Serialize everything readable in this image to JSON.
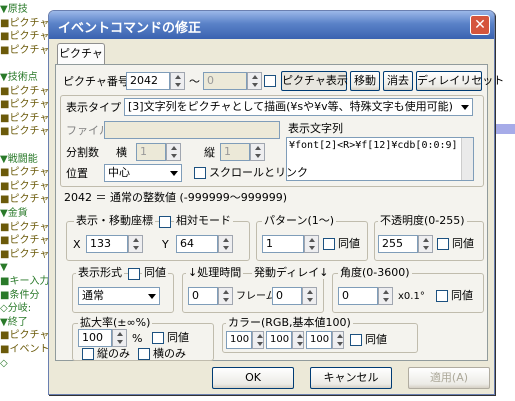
{
  "background_tree": {
    "rows": [
      {
        "prefix": "▼",
        "text": "原技",
        "cls": "tri"
      },
      {
        "prefix": "■",
        "text": "ピクチャ表",
        "cls": "sq"
      },
      {
        "prefix": "■",
        "text": "ピクチャ表",
        "cls": "sq"
      },
      {
        "prefix": "■",
        "text": "ピクチャ表",
        "cls": "sq"
      },
      {
        "prefix": "",
        "text": "",
        "cls": "sq"
      },
      {
        "prefix": "▼",
        "text": "技術点",
        "cls": "tri"
      },
      {
        "prefix": "■",
        "text": "ピクチャ表",
        "cls": "sq"
      },
      {
        "prefix": "■",
        "text": "ピクチャ表",
        "cls": "sq"
      },
      {
        "prefix": "■",
        "text": "ピクチャ表",
        "cls": "sq"
      },
      {
        "prefix": "■",
        "text": "ピクチャ表",
        "cls": "sq"
      },
      {
        "prefix": "",
        "text": "",
        "cls": "sq"
      },
      {
        "prefix": "▼",
        "text": "戦闘能",
        "cls": "tri"
      },
      {
        "prefix": "■",
        "text": "ピクチャ表",
        "cls": "sq"
      },
      {
        "prefix": "■",
        "text": "ピクチャ表",
        "cls": "sq"
      },
      {
        "prefix": "■",
        "text": "ピクチャ表",
        "cls": "sq"
      },
      {
        "prefix": "▼",
        "text": "金貨",
        "cls": "tri"
      },
      {
        "prefix": "■",
        "text": "ピクチャ表",
        "cls": "sq"
      },
      {
        "prefix": "■",
        "text": "ピクチャ表",
        "cls": "sq"
      },
      {
        "prefix": "■",
        "text": "ピクチャ表",
        "cls": "sq"
      },
      {
        "prefix": "▼",
        "text": "",
        "cls": "tri"
      },
      {
        "prefix": "■",
        "text": "キー入力",
        "cls": "tg"
      },
      {
        "prefix": "■",
        "text": "条件分",
        "cls": "tg"
      },
      {
        "prefix": "◇",
        "text": "分岐:",
        "cls": "tg"
      },
      {
        "prefix": " ▼",
        "text": "終了",
        "cls": "tri"
      },
      {
        "prefix": "  ■",
        "text": "ピクチャ",
        "cls": "sq"
      },
      {
        "prefix": "  ■",
        "text": "イベント",
        "cls": "sq"
      },
      {
        "prefix": "  ◇",
        "text": "",
        "cls": "tg"
      }
    ]
  },
  "dialog": {
    "title": "イベントコマンドの修正",
    "close": "✕",
    "tab": "ピクチャ",
    "picture_no_label": "ピクチャ番号",
    "picture_no": "2042",
    "tilde": "～",
    "picture_no_to": "0",
    "btn_show": "ピクチャ表示",
    "btn_move": "移動",
    "btn_erase": "消去",
    "btn_delay_reset": "ディレイリセット",
    "display_type_label": "表示タイプ",
    "display_type_value": "[3]文字列をピクチャとして描画(¥sや¥v等、特殊文字も使用可能)",
    "file_label": "ファイル",
    "display_text_label": "表示文字列",
    "display_text": "¥font[2]<R>¥f[12]¥cdb[0:0:9]",
    "split_label": "分割数",
    "split_h_label": "横",
    "split_h": "1",
    "split_v_label": "縦",
    "split_v": "1",
    "position_label": "位置",
    "position_value": "中心",
    "scroll_link_label": "スクロールとリンク",
    "value_info": "2042 ＝ 通常の整数値 (-999999～999999)",
    "coord_group": "表示・移動座標",
    "relative_mode": "相対モード",
    "x_label": "X",
    "x_value": "133",
    "y_label": "Y",
    "y_value": "64",
    "pattern_group": "パターン(1～)",
    "pattern_value": "1",
    "same_value": "同値",
    "opacity_group": "不透明度(0-255)",
    "opacity_value": "255",
    "display_format_group": "表示形式",
    "display_format_value": "通常",
    "process_time_group": "↓処理時間",
    "delay_group": "発動ディレイ↓",
    "process_time_value": "0",
    "frame_label": "フレーム",
    "delay_value": "0",
    "angle_group": "角度(0-3600)",
    "angle_value": "0",
    "angle_unit": "x0.1°",
    "scale_group": "拡大率(±∞%)",
    "scale_value": "100",
    "percent": "%",
    "vertical_only": "縦のみ",
    "horizontal_only": "横のみ",
    "color_group": "カラー(RGB,基本値100)",
    "color_r": "100",
    "color_g": "100",
    "color_b": "100",
    "ok": "OK",
    "cancel": "キャンセル",
    "apply": "適用(A)"
  },
  "colors": {
    "titlebar": "#3a62b0",
    "panel": "#f4f3ee",
    "dialog_bg": "#ece9d8",
    "tree_green": "#2a7a2a",
    "tree_brown": "#6b5a0a",
    "accent_blue": "#a6abe8"
  }
}
